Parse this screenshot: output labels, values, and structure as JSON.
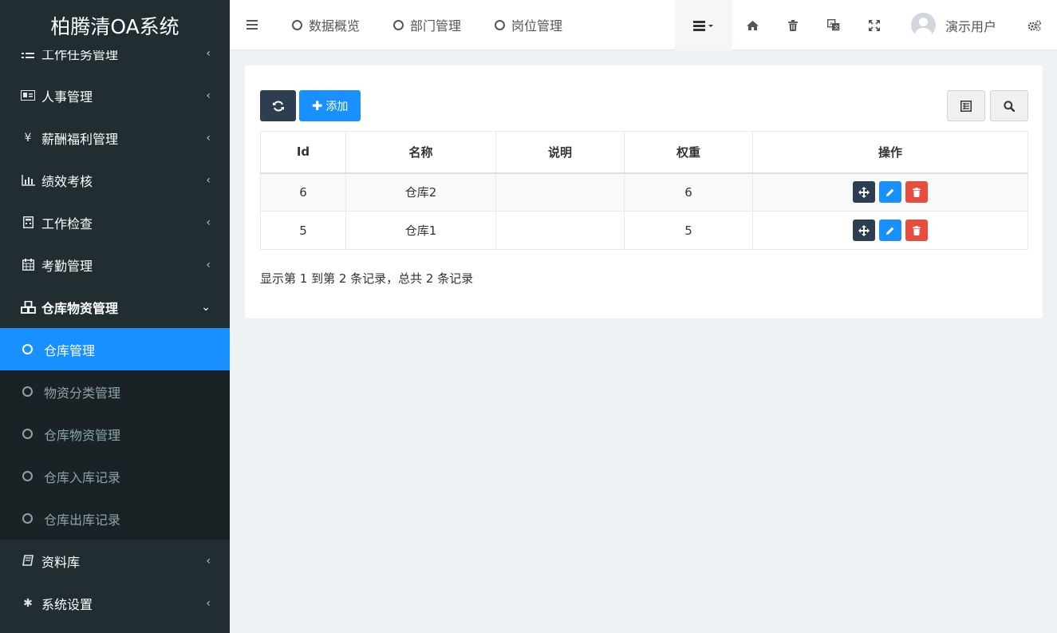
{
  "app": {
    "title": "柏腾清OA系统"
  },
  "sidebar": {
    "items": [
      {
        "label": "工作任务管理",
        "icon": "list-icon"
      },
      {
        "label": "人事管理",
        "icon": "id-card-icon"
      },
      {
        "label": "薪酬福利管理",
        "icon": "yen-icon"
      },
      {
        "label": "绩效考核",
        "icon": "bar-chart-icon"
      },
      {
        "label": "工作检查",
        "icon": "calculator-icon"
      },
      {
        "label": "考勤管理",
        "icon": "calendar-icon"
      },
      {
        "label": "仓库物资管理",
        "icon": "cubes-icon",
        "expanded": true
      }
    ],
    "submenu": [
      {
        "label": "仓库管理",
        "active": true
      },
      {
        "label": "物资分类管理"
      },
      {
        "label": "仓库物资管理"
      },
      {
        "label": "仓库入库记录"
      },
      {
        "label": "仓库出库记录"
      }
    ],
    "bottom_items": [
      {
        "label": "资料库",
        "icon": "book-icon"
      },
      {
        "label": "系统设置",
        "icon": "gear-icon"
      }
    ]
  },
  "topbar": {
    "tabs": [
      "数据概览",
      "部门管理",
      "岗位管理"
    ],
    "user_name": "演示用户"
  },
  "toolbar": {
    "add_label": "添加"
  },
  "table": {
    "columns": [
      "Id",
      "名称",
      "说明",
      "权重",
      "操作"
    ],
    "rows": [
      {
        "id": "6",
        "name": "仓库2",
        "desc": "",
        "weight": "6"
      },
      {
        "id": "5",
        "name": "仓库1",
        "desc": "",
        "weight": "5"
      }
    ]
  },
  "pagination": {
    "summary": "显示第 1 到第 2 条记录，总共 2 条记录"
  },
  "colors": {
    "primary": "#1890ff",
    "sidebar_bg": "#222d32",
    "submenu_bg": "#1a2226",
    "dark_button": "#2c3e50",
    "danger": "#e74c3c"
  }
}
